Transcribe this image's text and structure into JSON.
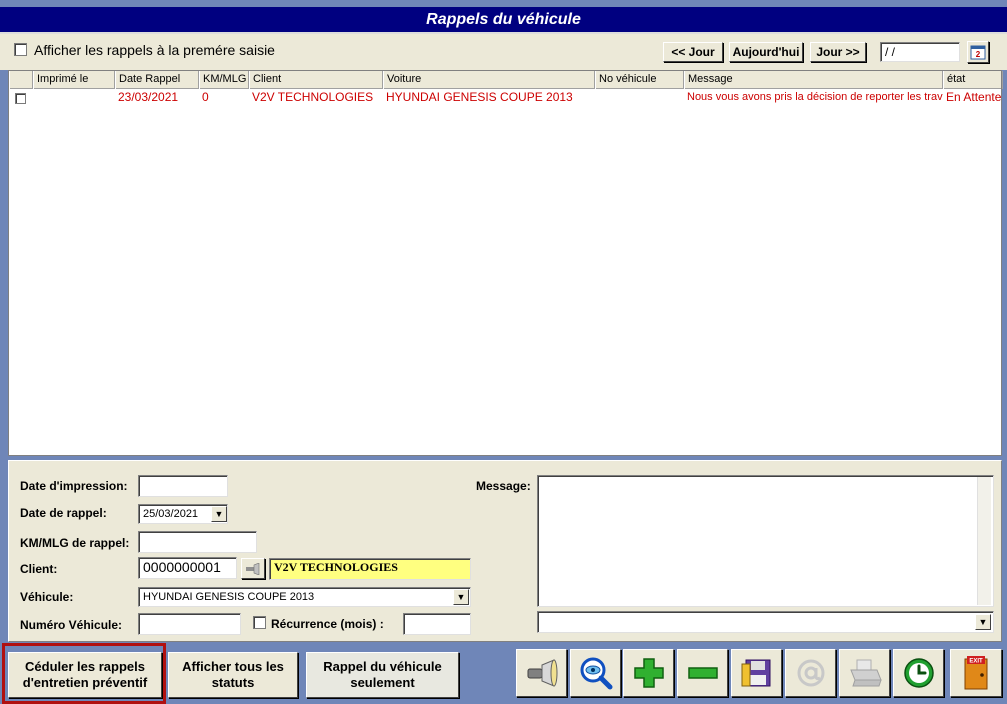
{
  "window": {
    "title": "Rappels du véhicule"
  },
  "topbar": {
    "show_first_entry_label": "Afficher les rappels à  la premére saisie",
    "prev_day": "<< Jour",
    "today": "Aujourd'hui",
    "next_day": "Jour >>",
    "date_value": " / /"
  },
  "grid": {
    "columns": [
      "Imprimé le",
      "Date Rappel",
      "KM/MLG",
      "Client",
      "Voiture",
      "No véhicule",
      "Message",
      "état"
    ],
    "rows": [
      {
        "printed": "",
        "date_rappel": "23/03/2021",
        "km": "0",
        "client": "V2V TECHNOLOGIES",
        "voiture": "HYUNDAI GENESIS COUPE 2013",
        "no_vehicule": "",
        "message": "Nous vous avons pris la décision de reporter les travaux",
        "etat": "En Attente"
      }
    ]
  },
  "form": {
    "date_impression_label": "Date d'impression:",
    "date_impression_value": "",
    "date_rappel_label": "Date de rappel:",
    "date_rappel_value": "25/03/2021",
    "km_label": "KM/MLG de rappel:",
    "km_value": "",
    "client_label": "Client:",
    "client_code": "0000000001",
    "client_name": "V2V TECHNOLOGIES",
    "vehicule_label": "Véhicule:",
    "vehicule_value": "HYUNDAI GENESIS COUPE 2013",
    "numero_label": "Numéro Véhicule:",
    "numero_value": "",
    "recurrence_label": "Récurrence (mois) :",
    "recurrence_value": "",
    "message_label": "Message:",
    "message_value": "",
    "message_dropdown_value": ""
  },
  "buttons": {
    "schedule": "Céduler les rappels d'entretien préventif",
    "show_all": "Afficher tous les statuts",
    "vehicle_only": "Rappel du véhicule seulement",
    "exit_label": "EXIT"
  },
  "icons": [
    "flashlight-icon",
    "search-eye-icon",
    "add-icon",
    "remove-icon",
    "save-floppy-icon",
    "email-at-icon",
    "print-icon",
    "clock-icon",
    "exit-door-icon"
  ]
}
